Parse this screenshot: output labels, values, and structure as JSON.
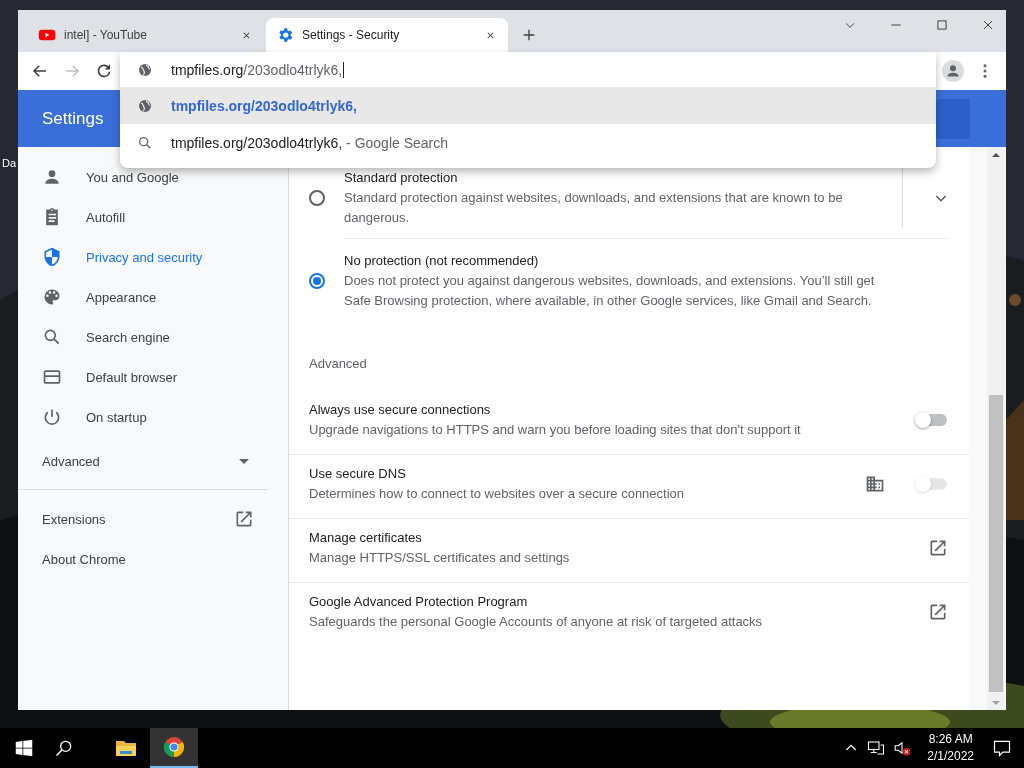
{
  "desktop": {
    "icon_label": "Da"
  },
  "tabs": [
    {
      "title": "intel] - YouTube",
      "selected": false
    },
    {
      "title": "Settings - Security",
      "selected": true
    }
  ],
  "omnibox": {
    "host": "tmpfiles.org",
    "path": "/203odlo4trlyk6,",
    "suggestions": [
      {
        "kind": "url",
        "text": "tmpfiles.org/203odlo4trlyk6,",
        "selected": true
      },
      {
        "kind": "search",
        "text": "tmpfiles.org/203odlo4trlyk6,",
        "suffix": "- Google Search",
        "selected": false
      }
    ]
  },
  "header": {
    "title": "Settings"
  },
  "sidebar": {
    "items": [
      {
        "label": "You and Google",
        "selected": false
      },
      {
        "label": "Autofill",
        "selected": false
      },
      {
        "label": "Privacy and security",
        "selected": true
      },
      {
        "label": "Appearance",
        "selected": false
      },
      {
        "label": "Search engine",
        "selected": false
      },
      {
        "label": "Default browser",
        "selected": false
      },
      {
        "label": "On startup",
        "selected": false
      }
    ],
    "advanced": {
      "label": "Advanced",
      "expanded": false
    },
    "links": [
      {
        "label": "Extensions",
        "external": true
      },
      {
        "label": "About Chrome",
        "external": false
      }
    ]
  },
  "safe_browsing": [
    {
      "title": "Standard protection",
      "description": "Standard protection against websites, downloads, and extensions that are known to be dangerous.",
      "selected": false,
      "expandable": true
    },
    {
      "title": "No protection (not recommended)",
      "description": "Does not protect you against dangerous websites, downloads, and extensions. You’ll still get Safe Browsing protection, where available, in other Google services, like Gmail and Search.",
      "selected": true,
      "expandable": false
    }
  ],
  "advanced": {
    "heading": "Advanced",
    "rows": [
      {
        "kind": "toggle",
        "title": "Always use secure connections",
        "description": "Upgrade navigations to HTTPS and warn you before loading sites that don't support it",
        "on": false,
        "disabled": false,
        "managed": false
      },
      {
        "kind": "toggle",
        "title": "Use secure DNS",
        "description": "Determines how to connect to websites over a secure connection",
        "on": false,
        "disabled": true,
        "managed": true
      },
      {
        "kind": "link",
        "title": "Manage certificates",
        "description": "Manage HTTPS/SSL certificates and settings"
      },
      {
        "kind": "link",
        "title": "Google Advanced Protection Program",
        "description": "Safeguards the personal Google Accounts of anyone at risk of targeted attacks"
      }
    ]
  },
  "taskbar": {
    "apps": [
      {
        "selected": false
      },
      {
        "selected": true
      }
    ],
    "volume_muted": true,
    "time": "8:26 AM",
    "date": "2/1/2022"
  }
}
